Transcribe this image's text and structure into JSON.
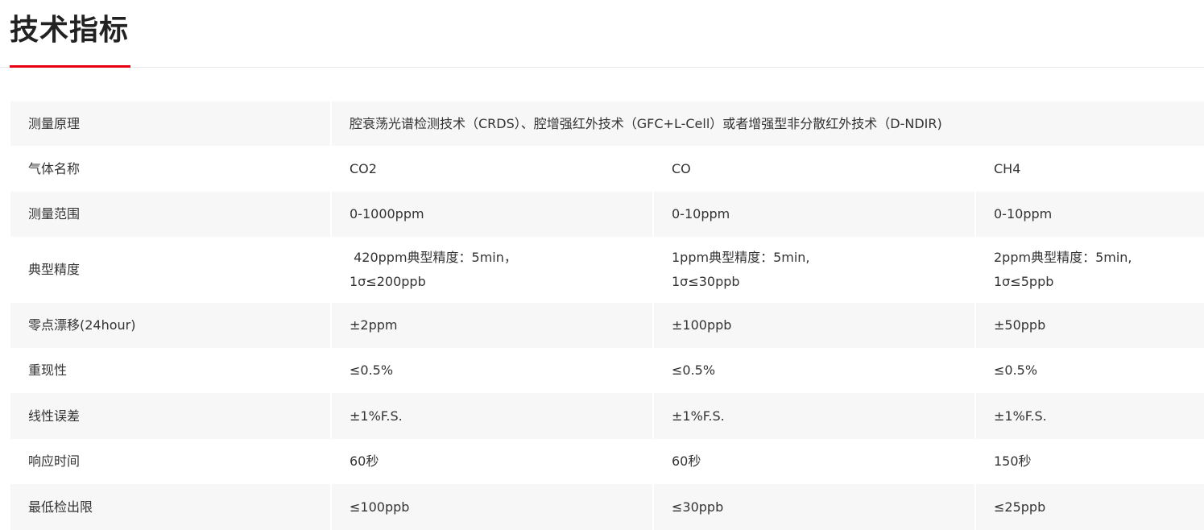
{
  "section": {
    "title": "技术指标"
  },
  "spec_table": {
    "rows": [
      {
        "label": "测量原理",
        "merged": "腔衰荡光谱检测技术（CRDS）、腔增强红外技术（GFC+L-Cell）或者增强型非分散红外技术（D-NDIR)"
      },
      {
        "label": "气体名称",
        "values": [
          "CO2",
          "CO",
          "CH4"
        ]
      },
      {
        "label": "测量范围",
        "values": [
          "0-1000ppm",
          "0-10ppm",
          "0-10ppm"
        ]
      },
      {
        "label": "典型精度",
        "values": [
          " 420ppm典型精度：5min，",
          "1ppm典型精度：5min,",
          "2ppm典型精度：5min,"
        ],
        "values2": [
          "1σ≤200ppb",
          "1σ≤30ppb",
          "1σ≤5ppb"
        ]
      },
      {
        "label": "零点漂移(24hour)",
        "values": [
          "±2ppm",
          "±100ppb",
          "±50ppb"
        ]
      },
      {
        "label": "重现性",
        "values": [
          "≤0.5%",
          "≤0.5%",
          "≤0.5%"
        ]
      },
      {
        "label": "线性误差",
        "values": [
          "±1%F.S.",
          "±1%F.S.",
          "±1%F.S."
        ]
      },
      {
        "label": "响应时间",
        "values": [
          "60秒",
          "60秒",
          "150秒"
        ]
      },
      {
        "label": "最低检出限",
        "values": [
          "≤100ppb",
          "≤30ppb",
          "≤25ppb"
        ]
      }
    ]
  },
  "colors": {
    "accent": "#e60012",
    "row_shade": "#f7f7f7",
    "text": "#333333"
  }
}
